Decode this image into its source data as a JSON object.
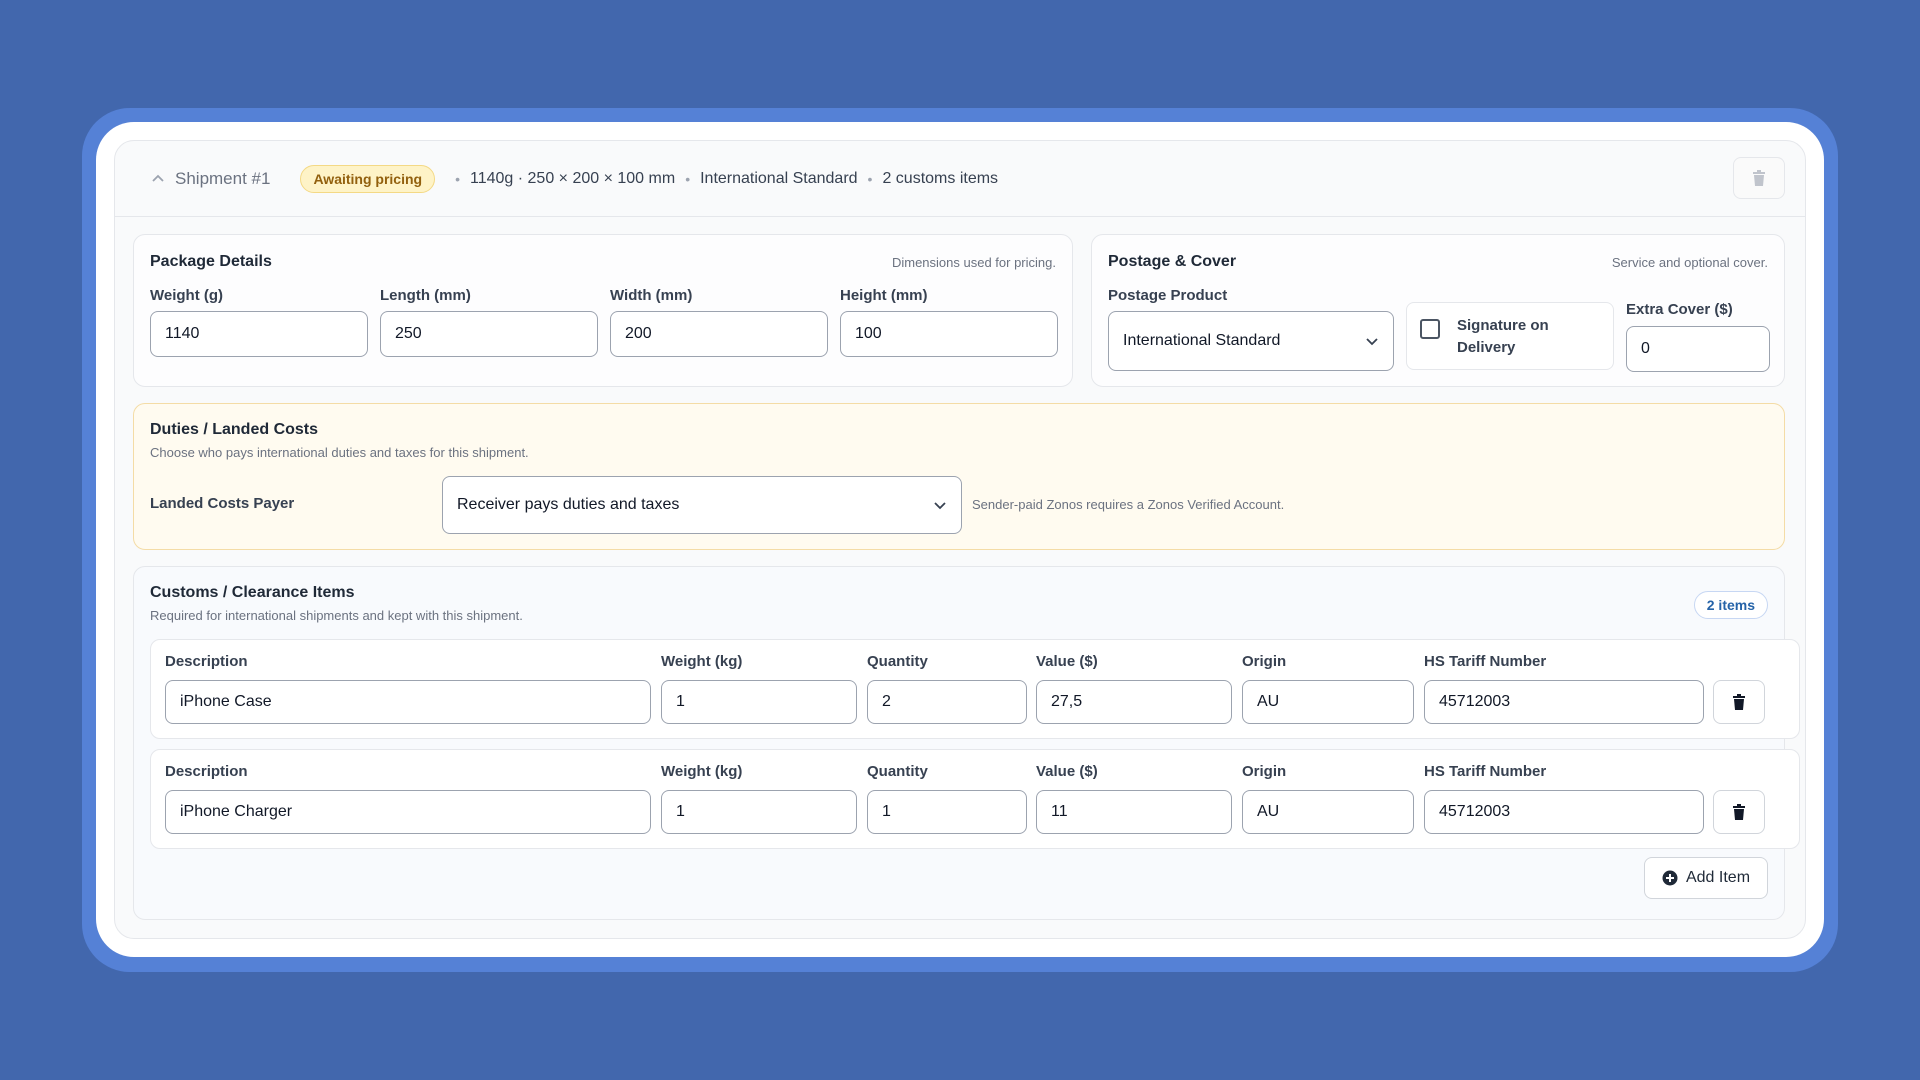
{
  "header": {
    "shipment_title": "Shipment #1",
    "status_badge": "Awaiting pricing",
    "summary_weight_dims": "1140g · 250 × 200 × 100 mm",
    "summary_service": "International Standard",
    "summary_items": "2 customs items"
  },
  "package": {
    "title": "Package Details",
    "note": "Dimensions used for pricing.",
    "weight_label": "Weight (g)",
    "weight_value": "1140",
    "length_label": "Length (mm)",
    "length_value": "250",
    "width_label": "Width (mm)",
    "width_value": "200",
    "height_label": "Height (mm)",
    "height_value": "100"
  },
  "postage": {
    "title": "Postage & Cover",
    "note": "Service and optional cover.",
    "product_label": "Postage Product",
    "product_value": "International Standard",
    "signature_label": "Signature on Delivery",
    "signature_checked": false,
    "cover_label": "Extra Cover ($)",
    "cover_value": "0"
  },
  "duties": {
    "title": "Duties / Landed Costs",
    "subtitle": "Choose who pays international duties and taxes for this shipment.",
    "payer_label": "Landed Costs Payer",
    "payer_value": "Receiver pays duties and taxes",
    "payer_note": "Sender-paid Zonos requires a Zonos Verified Account."
  },
  "customs": {
    "title": "Customs / Clearance Items",
    "subtitle": "Required for international shipments and kept with this shipment.",
    "count_badge": "2 items",
    "columns": {
      "description": "Description",
      "weight": "Weight (kg)",
      "quantity": "Quantity",
      "value": "Value ($)",
      "origin": "Origin",
      "hs": "HS Tariff Number"
    },
    "items": [
      {
        "description": "iPhone Case",
        "weight": "1",
        "quantity": "2",
        "value": "27,5",
        "origin": "AU",
        "hs": "45712003"
      },
      {
        "description": "iPhone Charger",
        "weight": "1",
        "quantity": "1",
        "value": "11",
        "origin": "AU",
        "hs": "45712003"
      }
    ],
    "add_label": "Add Item"
  },
  "colors": {
    "background": "#4267ad",
    "badge_warning": "#fef3c7",
    "duties_panel": "#fffbf0",
    "accent_blue": "#2563a8"
  }
}
